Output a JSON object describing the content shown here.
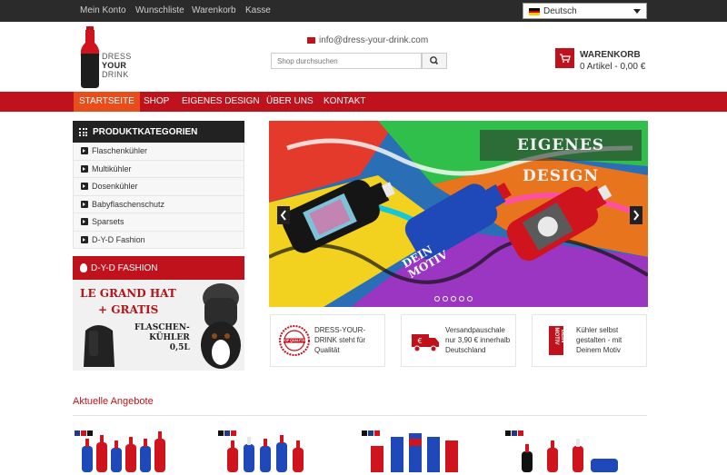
{
  "topbar": {
    "links": [
      "Mein Konto",
      "Wunschliste",
      "Warenkorb",
      "Kasse"
    ],
    "language": "Deutsch"
  },
  "header": {
    "logo_text": [
      "DRESS",
      "YOUR",
      "DRINK"
    ],
    "email": "info@dress-your-drink.com",
    "search_placeholder": "Shop durchsuchen",
    "cart_title": "WARENKORB",
    "cart_summary": "0 Artikel - 0,00 €"
  },
  "nav": {
    "items": [
      "STARTSEITE",
      "SHOP",
      "EIGENES DESIGN",
      "ÜBER UNS",
      "KONTAKT"
    ],
    "active": 0
  },
  "sidebar": {
    "categories_title": "PRODUKTKATEGORIEN",
    "categories": [
      "Flaschenkühler",
      "Multikühler",
      "Dosenkühler",
      "Babyflaschenschutz",
      "Sparsets",
      "D-Y-D Fashion"
    ],
    "fashion_title": "D-Y-D FASHION",
    "fashion_banner": {
      "line1": "LE GRAND HAT",
      "line2": "+ GRATIS",
      "line3": "FLASCHEN-",
      "line4": "KÜHLER",
      "line5": "0,5L"
    }
  },
  "slider": {
    "title": "EIGENES DESIGN",
    "bottle_text": [
      "DEIN",
      "MOTIV"
    ]
  },
  "features": [
    {
      "text": "DRESS-YOUR-DRINK steht für Qualität",
      "icon": "quality-seal-icon",
      "badge": "TOP QUALITÄT"
    },
    {
      "text": "Versandpauschale nur 3,90 € innerhalb Deutschland",
      "icon": "truck-icon"
    },
    {
      "text": "Kühler selbst gestalten - mit Deinem Motiv",
      "icon": "dein-motiv-icon",
      "badge": "DEIN MOTIV"
    }
  ],
  "offers": {
    "title": "Aktuelle Angebote"
  },
  "colors": {
    "brand_red": "#c0121c",
    "active_nav": "#e84d1c",
    "topbar": "#2b2b2b"
  }
}
